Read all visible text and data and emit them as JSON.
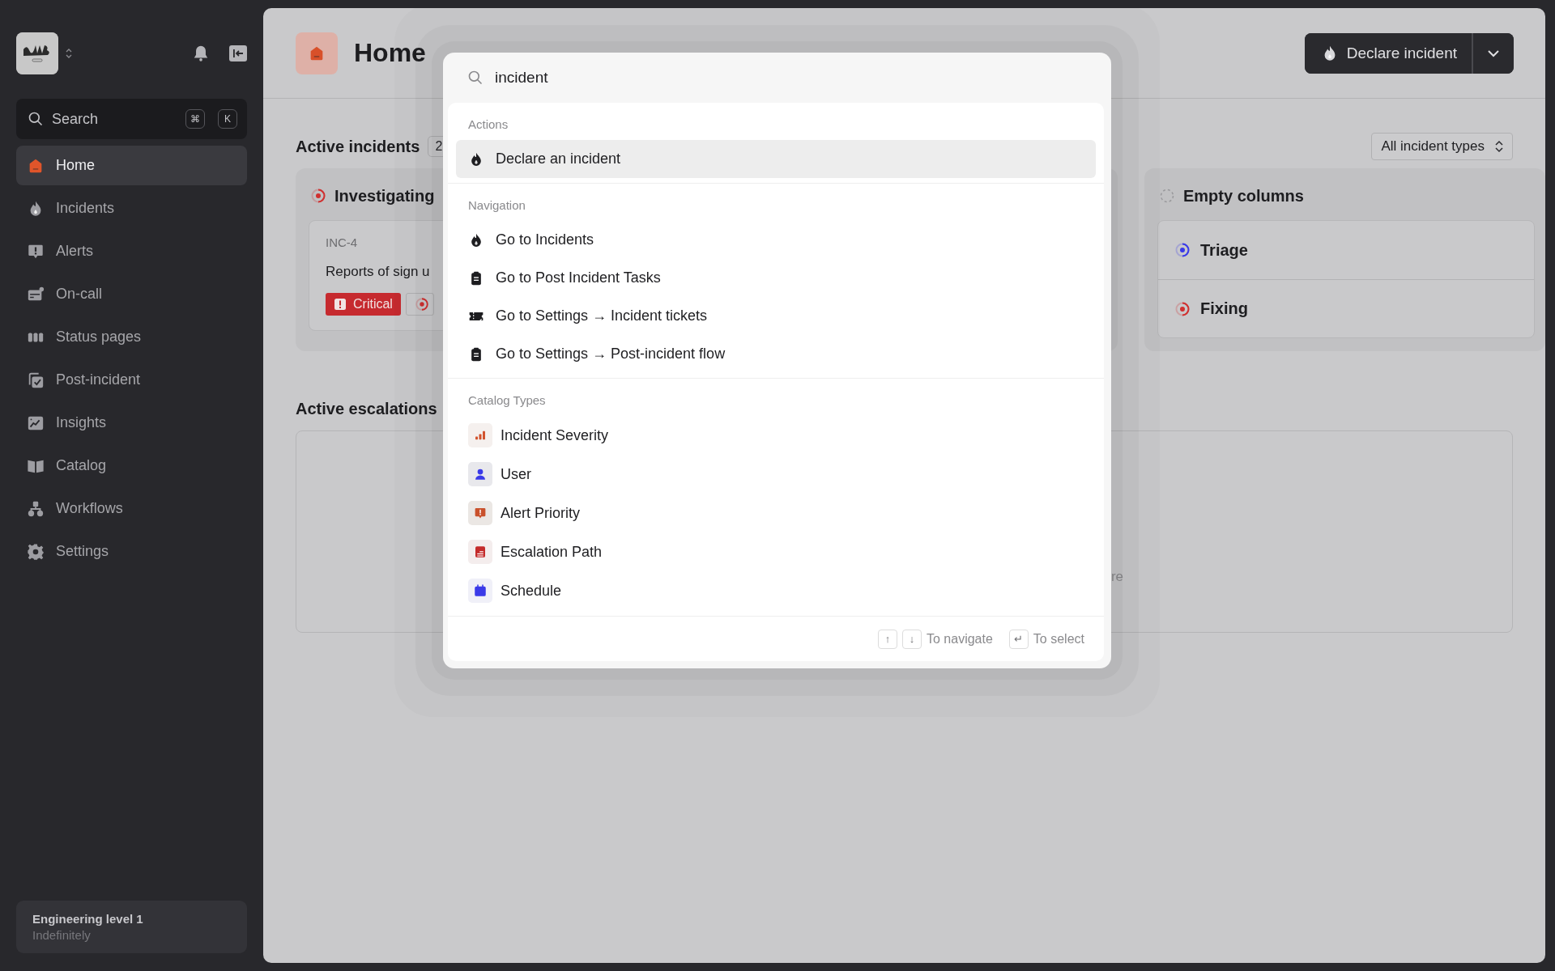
{
  "sidebar": {
    "search": {
      "placeholder": "Search",
      "shortcut": [
        "⌘",
        "K"
      ]
    },
    "items": [
      {
        "label": "Home",
        "selected": true
      },
      {
        "label": "Incidents",
        "selected": false
      },
      {
        "label": "Alerts",
        "selected": false
      },
      {
        "label": "On-call",
        "selected": false
      },
      {
        "label": "Status pages",
        "selected": false
      },
      {
        "label": "Post-incident",
        "selected": false
      },
      {
        "label": "Insights",
        "selected": false
      },
      {
        "label": "Catalog",
        "selected": false
      },
      {
        "label": "Workflows",
        "selected": false
      },
      {
        "label": "Settings",
        "selected": false
      }
    ],
    "footer": {
      "title": "Engineering level 1",
      "subtitle": "Indefinitely"
    }
  },
  "header": {
    "title": "Home",
    "primary_button": "Declare incident"
  },
  "active_incidents": {
    "title": "Active incidents",
    "count": "2",
    "filter": "All incident types",
    "columns": [
      {
        "kind": "status",
        "title": "Investigating",
        "color": "#d03030",
        "cards": [
          {
            "id": "INC-4",
            "title": "Reports of sign u",
            "severity": "Critical"
          }
        ]
      },
      {
        "kind": "empty",
        "title": "Empty columns",
        "statuses": [
          {
            "name": "Triage",
            "color": "#3a3ae8"
          },
          {
            "name": "Fixing",
            "color": "#d03030"
          }
        ]
      }
    ]
  },
  "active_escalations": {
    "title": "Active escalations",
    "empty_text": "re"
  },
  "palette": {
    "query": "incident",
    "sections": [
      {
        "title": "Actions",
        "items": [
          {
            "label": "Declare an incident",
            "selected": true
          }
        ]
      },
      {
        "title": "Navigation",
        "items": [
          {
            "label": "Go to Incidents",
            "selected": false
          },
          {
            "label": "Go to Post Incident Tasks",
            "selected": false
          },
          {
            "label": "Go to Settings → Incident tickets",
            "selected": false
          },
          {
            "label": "Go to Settings → Post-incident flow",
            "selected": false
          }
        ]
      },
      {
        "title": "Catalog Types",
        "items": [
          {
            "label": "Incident Severity",
            "selected": false
          },
          {
            "label": "User",
            "selected": false
          },
          {
            "label": "Alert Priority",
            "selected": false
          },
          {
            "label": "Escalation Path",
            "selected": false
          },
          {
            "label": "Schedule",
            "selected": false
          }
        ]
      }
    ],
    "footer": {
      "navigate_keys": [
        "↑",
        "↓"
      ],
      "navigate_label": "To navigate",
      "select_key": "↵",
      "select_label": "To select"
    }
  }
}
